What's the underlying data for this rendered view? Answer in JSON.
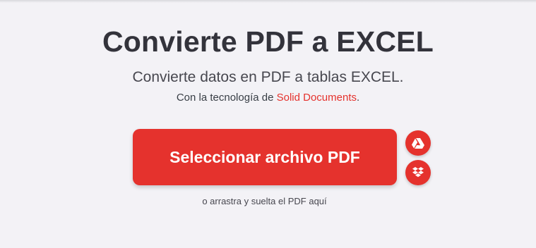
{
  "header": {
    "title": "Convierte PDF a EXCEL",
    "subtitle": "Convierte datos en PDF a tablas EXCEL.",
    "powered_prefix": "Con la tecnología de ",
    "powered_link": "Solid Documents",
    "powered_suffix": "."
  },
  "upload": {
    "select_label": "Seleccionar archivo PDF",
    "drop_hint": "o arrastra y suelta el PDF aquí",
    "cloud_sources": [
      {
        "icon": "google-drive-icon"
      },
      {
        "icon": "dropbox-icon"
      }
    ]
  },
  "colors": {
    "accent": "#e5322d",
    "background": "#f3f2f6",
    "title": "#33333b"
  }
}
